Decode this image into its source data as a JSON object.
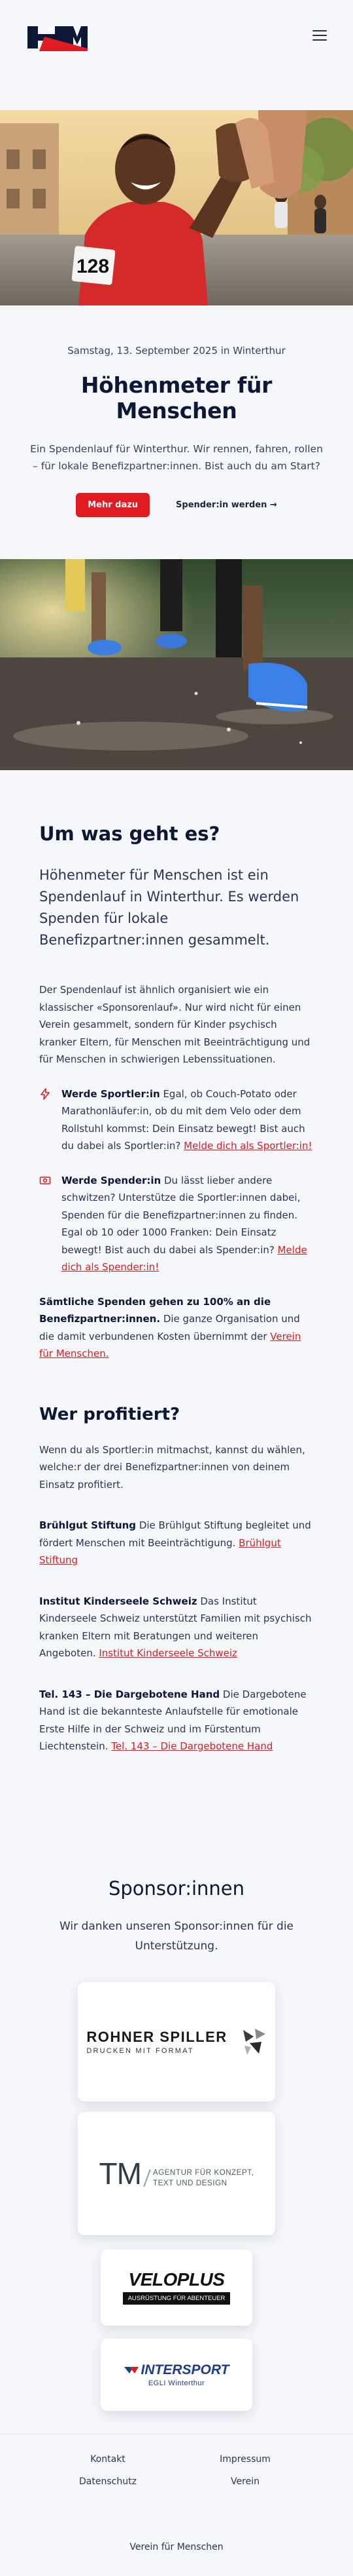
{
  "header": {
    "logo_text": "HBM",
    "menu_icon": "hamburger-icon"
  },
  "intro": {
    "date": "Samstag, 13. September 2025 in Winterthur",
    "title": "Höhenmeter für Menschen",
    "text": "Ein Spendenlauf für Winterthur. Wir rennen, fahren, rollen – für lokale Benefizpartner:innen. Bist auch du am Start?",
    "primary_cta": "Mehr dazu",
    "secondary_cta": "Spender:in werden →"
  },
  "hero": {
    "bib_number": "128"
  },
  "about": {
    "heading": "Um was geht es?",
    "lead": "Höhenmeter für Menschen ist ein Spendenlauf in Winterthur. Es werden Spenden für lokale Benefizpartner:innen gesammelt.",
    "p1": "Der Spendenlauf ist ähnlich organisiert wie ein klassischer «Sponsorenlauf». Nur wird nicht für einen Verein gesammelt, sondern für Kinder psychisch kranker Eltern, für Menschen mit Beeinträchtigung und für Menschen in schwierigen Lebenssituationen.",
    "runner_title": "Werde Sportler:in",
    "runner_text": " Egal, ob Couch-Potato oder Marathonläufer:in, ob du mit dem Velo oder dem Rollstuhl kommst: Dein Einsatz bewegt! Bist auch du dabei als Sportler:in? ",
    "runner_link": "Melde dich als Sportler:in!",
    "donor_title": "Werde Spender:in",
    "donor_text": " Du lässt lieber andere schwitzen? Unterstütze die Sportler:innen dabei, Spenden für die Benefizpartner:innen zu finden. Egal ob 10 oder 1000 Franken: Dein Einsatz bewegt! Bist auch du dabei als Spender:in? ",
    "donor_link": "Melde dich als Spender:in!",
    "final_bold": "Sämtliche Spenden gehen zu 100% an die Benefizpartner:innen.",
    "final_text": " Die ganze Organisation und die damit verbundenen Kosten übernimmt der ",
    "final_link": "Verein für Menschen."
  },
  "beneficiaries": {
    "heading": "Wer profitiert?",
    "intro": "Wenn du als Sportler:in mitmachst, kannst du wählen, welche:r der drei Benefizpartner:innen von deinem Einsatz profitiert.",
    "items": [
      {
        "name": "Brühlgut Stiftung",
        "text": " Die Brühlgut Stiftung begleitet und fördert Menschen mit Beeinträchtigung. ",
        "link": "Brühlgut Stiftung"
      },
      {
        "name": "Institut Kinderseele Schweiz",
        "text": " Das Institut Kinderseele Schweiz unterstützt Familien mit psychisch kranken Eltern mit Beratungen und weiteren Angeboten. ",
        "link": "Institut Kinderseele Schweiz"
      },
      {
        "name": "Tel. 143 – Die Dargebotene Hand",
        "text": " Die Dargebotene Hand ist die bekannteste Anlaufstelle für emotionale Erste Hilfe in der Schweiz und im Fürstentum Liechtenstein. ",
        "link": "Tel. 143 – Die Dargebotene Hand"
      }
    ]
  },
  "sponsors": {
    "heading": "Sponsor:innen",
    "sub": "Wir danken unseren Sponsor:innen für die Unterstützung.",
    "rohner_name": "ROHNER SPILLER",
    "rohner_tag": "DRUCKEN MIT FORMAT",
    "tm_mark": "TM",
    "tm_tag_line1": "AGENTUR FÜR KONZEPT,",
    "tm_tag_line2": "TEXT UND DESIGN",
    "veloplus_name": "VELOPLUS",
    "veloplus_tag": "AUSRÜSTUNG FÜR ABENTEUER",
    "intersport_name": "INTERSPORT",
    "intersport_tag": "EGLI Winterthur"
  },
  "footer": {
    "links": [
      "Kontakt",
      "Impressum",
      "Datenschutz",
      "Verein"
    ],
    "bottom": "Verein für Menschen"
  },
  "colors": {
    "accent": "#e11b22",
    "navy": "#0d1836",
    "background": "#f5f7fb"
  }
}
